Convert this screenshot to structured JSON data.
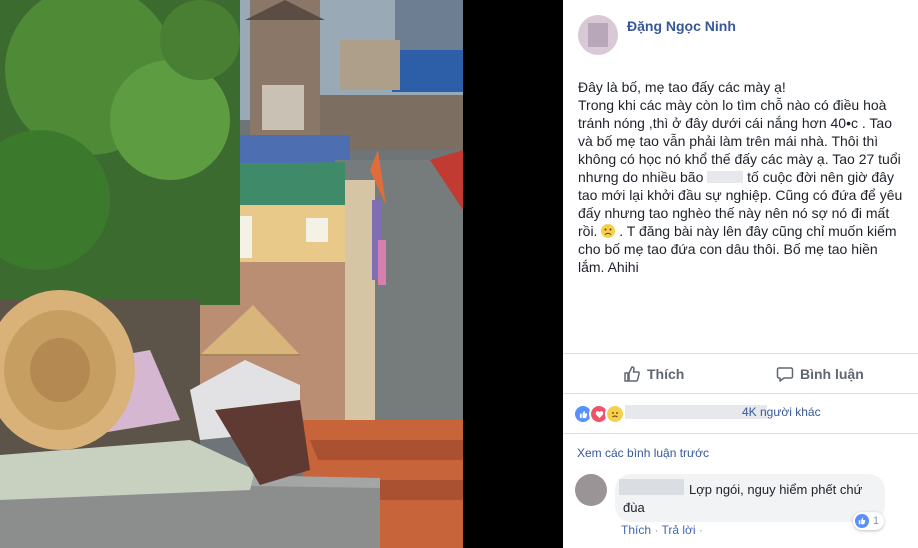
{
  "post": {
    "author": "Đặng Ngọc Ninh",
    "text_lines": [
      "Đây là bố, mẹ tao đấy các mày ạ!",
      "Trong khi các mày còn lo tìm chỗ nào có điều hoà",
      "tránh nóng ,thì ở đây dưới cái nắng hơn 40•c . Tao",
      "và bố mẹ tao vẫn phải làm trên mái nhà. Thôi thì",
      "không có học nó khổ thế đấy các mày ạ. Tao 27 tuổi",
      "nhưng do nhiều bão",
      "tố cuộc đời nên giờ đây",
      "tao mới lại khởi đầu sự nghiệp. Cũng có đứa để yêu",
      "đấy nhưng tao nghèo thế này nên nó sợ nó đi mất",
      "rồi.",
      ". T đăng bài này lên đây cũng chỉ muốn kiếm",
      "cho bố mẹ tao đứa con dâu thôi. Bố mẹ tao hiền",
      "lắm. Ahihi"
    ]
  },
  "actions": {
    "like": "Thích",
    "comment": "Bình luận"
  },
  "reactions": {
    "summary": "4K người khác",
    "icons": [
      "like-icon",
      "love-icon",
      "sad-icon"
    ]
  },
  "comments": {
    "view_previous": "Xem các bình luận trước",
    "items": [
      {
        "text": "Lợp ngói, nguy hiểm phết chứ đùa",
        "like_count": "1",
        "like_label": "Thích",
        "reply_label": "Trả lời",
        "separator": "·"
      }
    ]
  },
  "colors": {
    "link_blue": "#365899",
    "like_blue": "#5890ff",
    "love_red": "#f25268",
    "sad_yellow": "#f7d04b",
    "action_gray": "#606770"
  }
}
